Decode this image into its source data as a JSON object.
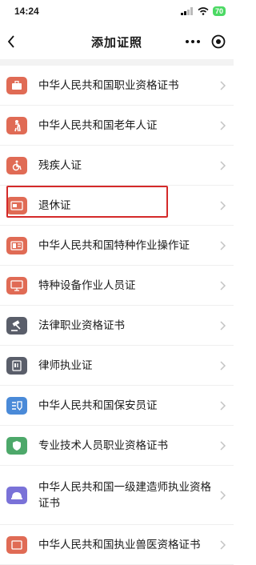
{
  "status": {
    "time": "14:24",
    "battery": "70"
  },
  "nav": {
    "title": "添加证照"
  },
  "items": [
    {
      "label": "中华人民共和国职业资格证书",
      "icon": "briefcase-icon",
      "color": "#e06b55"
    },
    {
      "label": "中华人民共和国老年人证",
      "icon": "elderly-person-icon",
      "color": "#e06b55"
    },
    {
      "label": "残疾人证",
      "icon": "wheelchair-icon",
      "color": "#e06b55"
    },
    {
      "label": "退休证",
      "icon": "card-icon",
      "color": "#e06b55"
    },
    {
      "label": "中华人民共和国特种作业操作证",
      "icon": "id-card-icon",
      "color": "#e06b55"
    },
    {
      "label": "特种设备作业人员证",
      "icon": "monitor-icon",
      "color": "#e06b55"
    },
    {
      "label": "法律职业资格证书",
      "icon": "gavel-icon",
      "color": "#5a5e6a"
    },
    {
      "label": "律师执业证",
      "icon": "document-icon",
      "color": "#5a5e6a"
    },
    {
      "label": "中华人民共和国保安员证",
      "icon": "security-icon",
      "color": "#4a8ad8"
    },
    {
      "label": "专业技术人员职业资格证书",
      "icon": "shield-icon",
      "color": "#4da86a"
    },
    {
      "label": "中华人民共和国一级建造师执业资格证书",
      "icon": "helmet-icon",
      "color": "#7a72d8"
    },
    {
      "label": "中华人民共和国执业兽医资格证书",
      "icon": "certificate-icon",
      "color": "#e06b55"
    }
  ]
}
